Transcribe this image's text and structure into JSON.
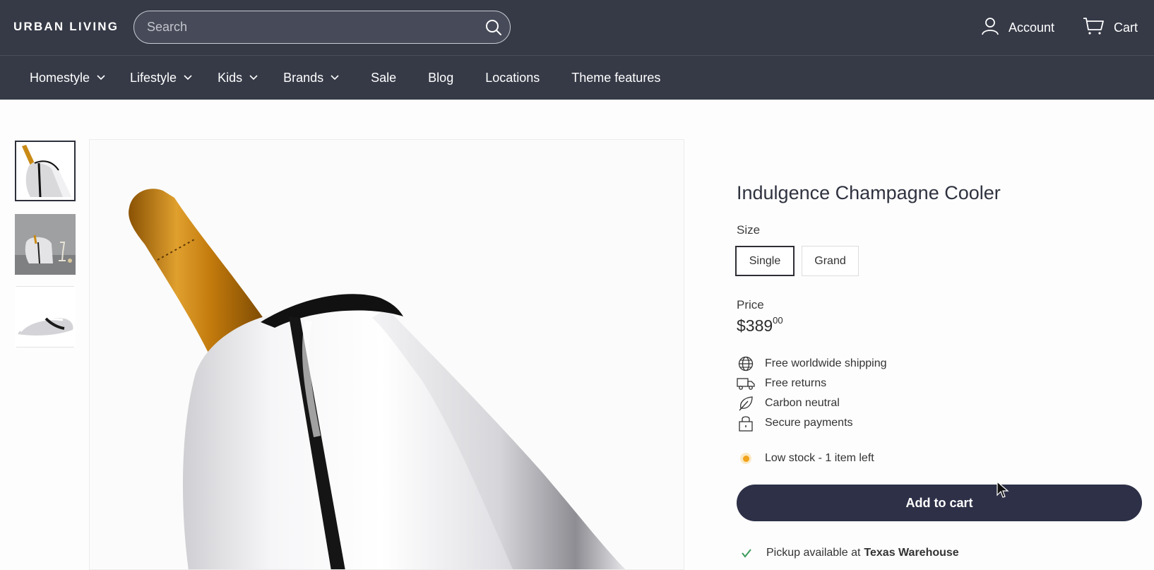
{
  "header": {
    "logo": "URBAN LIVING",
    "search": {
      "placeholder": "Search",
      "value": "",
      "icon": "search-icon"
    },
    "account": {
      "label": "Account",
      "icon": "person-icon"
    },
    "cart": {
      "label": "Cart",
      "icon": "cart-icon"
    }
  },
  "nav": {
    "items": [
      {
        "label": "Homestyle",
        "has_dropdown": true
      },
      {
        "label": "Lifestyle",
        "has_dropdown": true
      },
      {
        "label": "Kids",
        "has_dropdown": true
      },
      {
        "label": "Brands",
        "has_dropdown": true
      },
      {
        "label": "Sale",
        "has_dropdown": false
      },
      {
        "label": "Blog",
        "has_dropdown": false
      },
      {
        "label": "Locations",
        "has_dropdown": false
      },
      {
        "label": "Theme features",
        "has_dropdown": false
      }
    ]
  },
  "gallery": {
    "thumbnails": [
      {
        "name": "thumbnail-bottle-cooler",
        "selected": true
      },
      {
        "name": "thumbnail-lifestyle-scene",
        "selected": false
      },
      {
        "name": "thumbnail-cooler-side",
        "selected": false
      }
    ],
    "main_image": "champagne-bottle-in-silver-cooler"
  },
  "product": {
    "title": "Indulgence Champagne Cooler",
    "size_label": "Size",
    "size_options": [
      {
        "label": "Single",
        "selected": true
      },
      {
        "label": "Grand",
        "selected": false
      }
    ],
    "price_label": "Price",
    "price_main": "$389",
    "price_cents": "00",
    "features": [
      {
        "label": "Free worldwide shipping",
        "icon": "globe-icon"
      },
      {
        "label": "Free returns",
        "icon": "truck-icon"
      },
      {
        "label": "Carbon neutral",
        "icon": "leaf-icon"
      },
      {
        "label": "Secure payments",
        "icon": "lock-icon"
      }
    ],
    "stock_text": "Low stock - 1 item left",
    "stock_color": "#f0a31a",
    "add_to_cart_label": "Add to cart",
    "pickup_prefix": "Pickup available at",
    "pickup_location": "Texas Warehouse"
  },
  "colors": {
    "header_bg": "#363a47",
    "button_bg": "#2d3047",
    "accent_stock": "#f0a31a",
    "check_green": "#3a9b5a"
  }
}
